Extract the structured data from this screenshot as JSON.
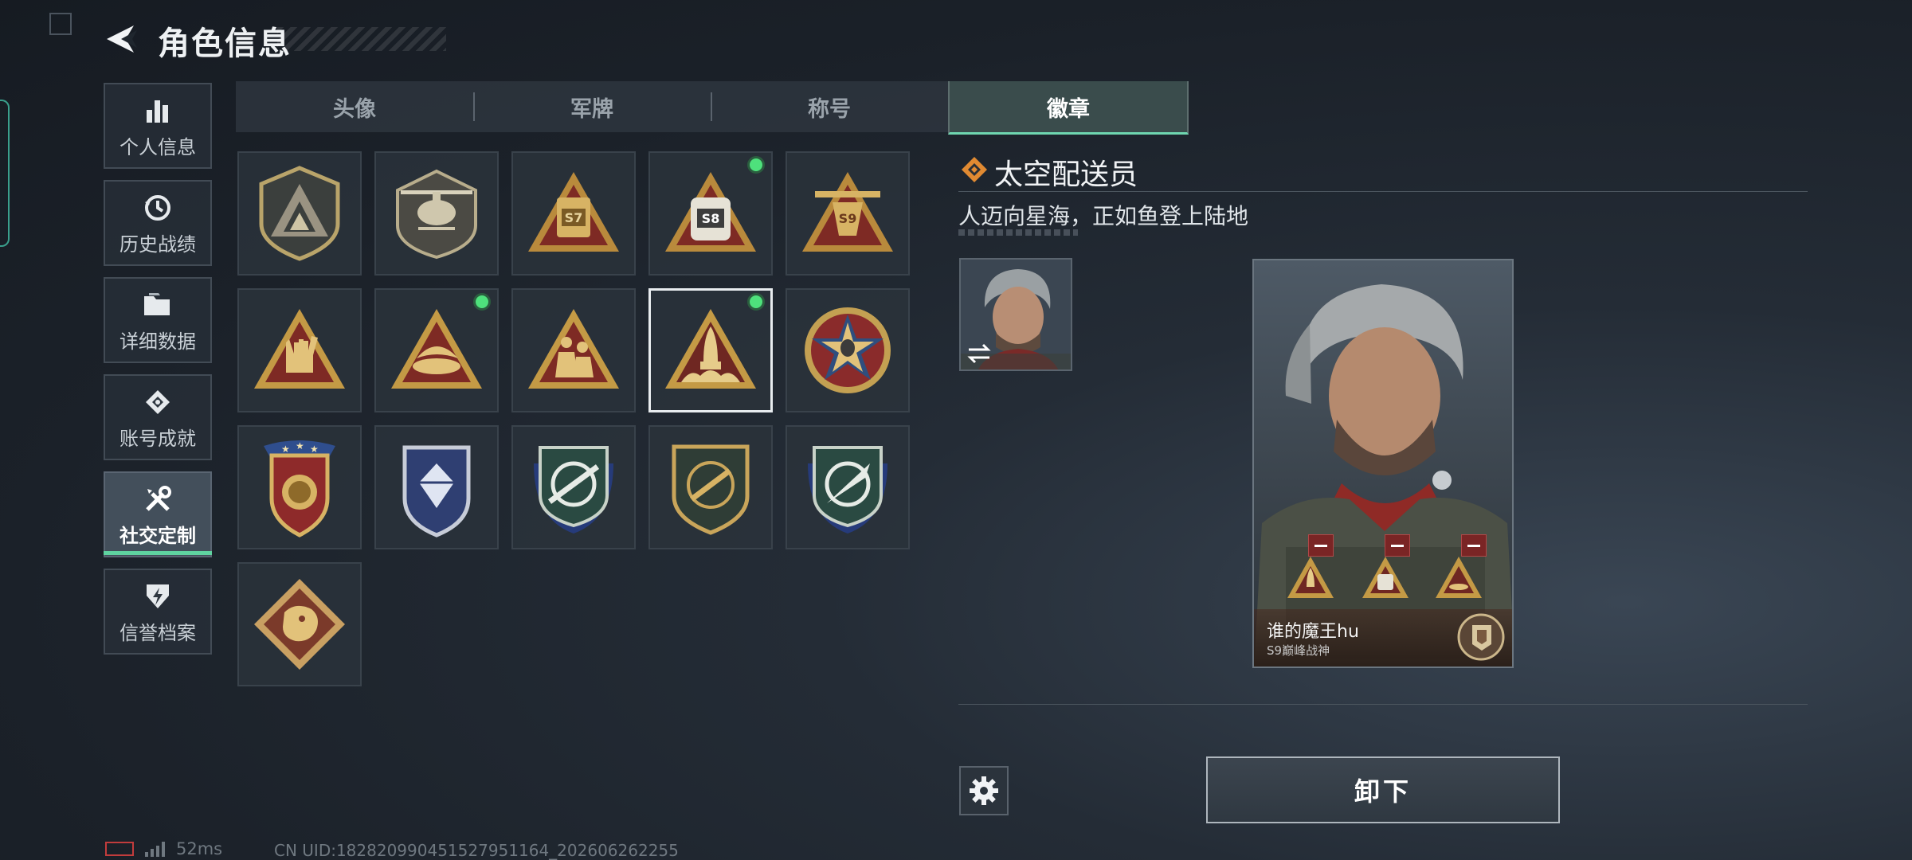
{
  "header": {
    "title": "角色信息"
  },
  "sidebar": {
    "items": [
      {
        "label": "个人信息",
        "icon": "bar-chart-icon"
      },
      {
        "label": "历史战绩",
        "icon": "history-clock-icon"
      },
      {
        "label": "详细数据",
        "icon": "folder-icon"
      },
      {
        "label": "账号成就",
        "icon": "achievement-icon"
      },
      {
        "label": "社交定制",
        "icon": "wrench-screwdriver-icon",
        "active": true
      },
      {
        "label": "信誉档案",
        "icon": "shield-bolt-icon"
      }
    ]
  },
  "tabs": [
    {
      "label": "头像"
    },
    {
      "label": "军牌"
    },
    {
      "label": "称号"
    },
    {
      "label": "徽章",
      "active": true
    }
  ],
  "badges": [
    {
      "name": "shield-mountain-badge",
      "new": false
    },
    {
      "name": "helicopter-badge",
      "new": false
    },
    {
      "name": "s7-season-badge",
      "new": false,
      "label": "S7"
    },
    {
      "name": "s8-season-badge",
      "new": true,
      "label": "S8"
    },
    {
      "name": "s9-season-badge",
      "new": false,
      "label": "S9"
    },
    {
      "name": "rock-hand-badge",
      "new": false
    },
    {
      "name": "bird-nest-badge",
      "new": true
    },
    {
      "name": "soldiers-badge",
      "new": false
    },
    {
      "name": "rocket-launch-badge",
      "new": true,
      "selected": true
    },
    {
      "name": "alien-star-badge",
      "new": false
    },
    {
      "name": "gold-crest-badge",
      "new": false
    },
    {
      "name": "blue-diamond-badge",
      "new": false
    },
    {
      "name": "crosshair-rifle-badge",
      "new": false
    },
    {
      "name": "gold-rifle-badge",
      "new": false
    },
    {
      "name": "crosshair-knife-badge",
      "new": false
    },
    {
      "name": "dragon-badge",
      "new": false
    }
  ],
  "detail": {
    "badge_name": "太空配送员",
    "description": "人迈向星海，正如鱼登上陆地"
  },
  "card": {
    "player_name": "谁的魔王hu",
    "player_subtitle": "S9巅峰战神"
  },
  "actions": {
    "unequip_label": "卸下"
  },
  "status": {
    "ping": "52ms",
    "uid": "CN UID:182820990451527951164_202606262255"
  },
  "colors": {
    "accent": "#5fd3a0",
    "new_dot": "#4ee17c",
    "gold": "#c9a55a"
  }
}
